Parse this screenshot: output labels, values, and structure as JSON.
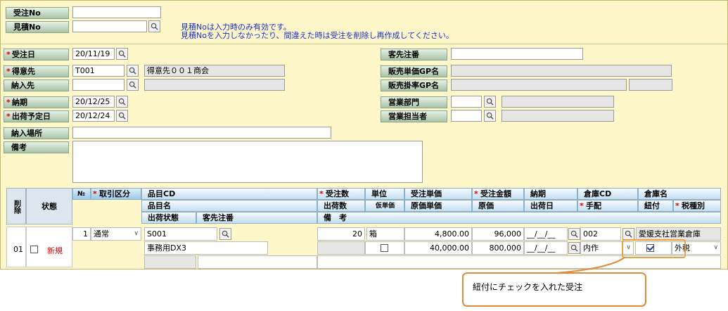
{
  "header": {
    "order_no_label": "受注No",
    "estimate_no_label": "見積No",
    "info_line1": "見積Noは入力時のみ有効です。",
    "info_line2": "見積Noを入力しなかったり、間違えた時は受注を削除し再作成してください。"
  },
  "form": {
    "order_date_label": "受注日",
    "order_date": "20/11/19",
    "customer_label": "得意先",
    "customer_code": "T001",
    "customer_name": "得意先００１商会",
    "delivery_to_label": "納入先",
    "due_date_label": "納期",
    "due_date": "20/12/25",
    "ship_date_label": "出荷予定日",
    "ship_date": "20/12/24",
    "delivery_place_label": "納入場所",
    "remarks_label": "備考",
    "customer_po_label": "客先注番",
    "unit_price_group_label": "販売単価GP名",
    "rate_group_label": "販売掛率GP名",
    "sales_dept_label": "営業部門",
    "sales_rep_label": "営業担当者"
  },
  "grid": {
    "headers": {
      "delete": "削除",
      "status": "状態",
      "no": "№",
      "trade_type": "取引区分",
      "item_cd": "品目CD",
      "item_name": "品目名",
      "ship_status": "出荷状態",
      "customer_po": "客先注番",
      "order_qty": "受注数",
      "unit": "単位",
      "order_unit_price": "受注単価",
      "order_amount": "受注金額",
      "due": "納期",
      "warehouse_cd": "倉庫CD",
      "warehouse_name": "倉庫名",
      "ship_qty": "出荷数",
      "temp_price": "仮単価",
      "cost_unit_price": "原価単価",
      "cost": "原価",
      "ship_date": "出荷日",
      "arrangement": "手配",
      "linked": "紐付",
      "tax_type": "税種別",
      "remarks": "備　考"
    },
    "row": {
      "row_no": "01",
      "status": "新規",
      "line_no": "1",
      "trade_type": "通常",
      "item_cd": "S001",
      "item_name": "事務用DX3",
      "order_qty": "20",
      "unit": "箱",
      "unit_price": "4,800.00",
      "amount": "96,000",
      "due": "__/__/__",
      "warehouse_cd": "002",
      "warehouse_name": "愛媛支社営業倉庫",
      "cost_unit_price": "40,000.00",
      "cost": "800,000",
      "ship_date": "__/__/__",
      "arrangement": "内作",
      "linked": true,
      "tax_type": "外税"
    }
  },
  "callout": {
    "text": "紐付にチェックを入れた受注"
  },
  "colors": {
    "panel_bg": "#fdf7c9",
    "label_bg": "#a9c3a9",
    "grid_header": "#c4deef",
    "required": "#e00000",
    "info_text": "#1a2fc8",
    "status_new": "#e00000",
    "callout_border": "#e08a3c"
  },
  "icons": [
    "search-icon",
    "chevron-down-icon",
    "checkbox-icon"
  ]
}
